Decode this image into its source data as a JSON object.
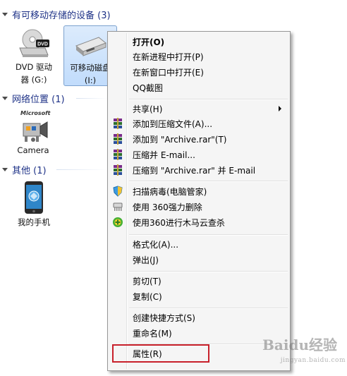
{
  "groups": [
    {
      "title": "有可移动存储的设备 (3)"
    },
    {
      "title": "网络位置 (1)"
    },
    {
      "title": "其他 (1)"
    }
  ],
  "items": {
    "dvd": {
      "label_line1": "DVD 驱动",
      "label_line2": "器 (G:)",
      "badge": "DVD"
    },
    "removable": {
      "label_line1": "可移动磁盘",
      "label_line2": "(I:)"
    },
    "camera": {
      "label": "Camera",
      "brand": "Microsoft"
    },
    "phone": {
      "label": "我的手机"
    }
  },
  "context_menu": {
    "open": "打开(O)",
    "open_new_process": "在新进程中打开(P)",
    "open_new_window": "在新窗口中打开(E)",
    "qq_screenshot": "QQ截图",
    "share": "共享(H)",
    "add_to_archive": "添加到压缩文件(A)...",
    "add_to_archive_rar": "添加到 \"Archive.rar\"(T)",
    "compress_email": "压缩并 E-mail...",
    "compress_rar_email": "压缩到 \"Archive.rar\" 并 E-mail",
    "scan_virus": "扫描病毒(电脑管家)",
    "force_delete_360": "使用 360强力删除",
    "trojan_scan_360": "使用360进行木马云查杀",
    "format": "格式化(A)...",
    "eject": "弹出(J)",
    "cut": "剪切(T)",
    "copy": "复制(C)",
    "create_shortcut": "创建快捷方式(S)",
    "rename": "重命名(M)",
    "properties": "属性(R)"
  },
  "watermark": {
    "main": "Baidu经验",
    "sub": "jingyan.baidu.com"
  },
  "colors": {
    "group_title": "#1e3287",
    "highlight_box": "#c8202b",
    "selection": "#c1dcfc"
  }
}
